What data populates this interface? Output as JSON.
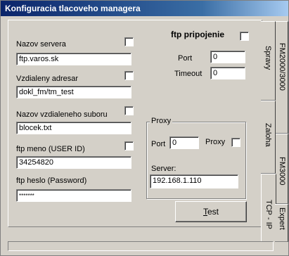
{
  "window": {
    "title": "Konfiguracia tlacoveho managera"
  },
  "form": {
    "server_name": {
      "label": "Nazov  servera",
      "value": "ftp.varos.sk"
    },
    "remote_dir": {
      "label": "Vzdialeny adresar",
      "value": "dokl_fm/tm_test"
    },
    "remote_file": {
      "label": "Nazov vzdialeneho suboru",
      "value": "blocek.txt"
    },
    "user_id": {
      "label": "ftp meno (USER ID)",
      "value": "34254820"
    },
    "password": {
      "label": "ftp heslo (Password)",
      "value": "*******"
    },
    "ftp_connection": {
      "label": "ftp pripojenie"
    },
    "port": {
      "label": "Port",
      "value": "0"
    },
    "timeout": {
      "label": "Timeout",
      "value": "0"
    },
    "proxy_group": {
      "title": "Proxy"
    },
    "proxy_port": {
      "label": "Port",
      "value": "0"
    },
    "proxy_check": {
      "label": "Proxy"
    },
    "proxy_server": {
      "label": "Server:",
      "value": "192.168.1.110"
    },
    "test_button": {
      "label_underlined": "T",
      "label_rest": "est"
    }
  },
  "tabs": {
    "fm2000": "FM2000/3000",
    "spravy": "Spravy",
    "fm3000": "FM3000",
    "zaloha": "Zaloha",
    "tcpip": "TCP - IP",
    "expert": "Expert"
  }
}
